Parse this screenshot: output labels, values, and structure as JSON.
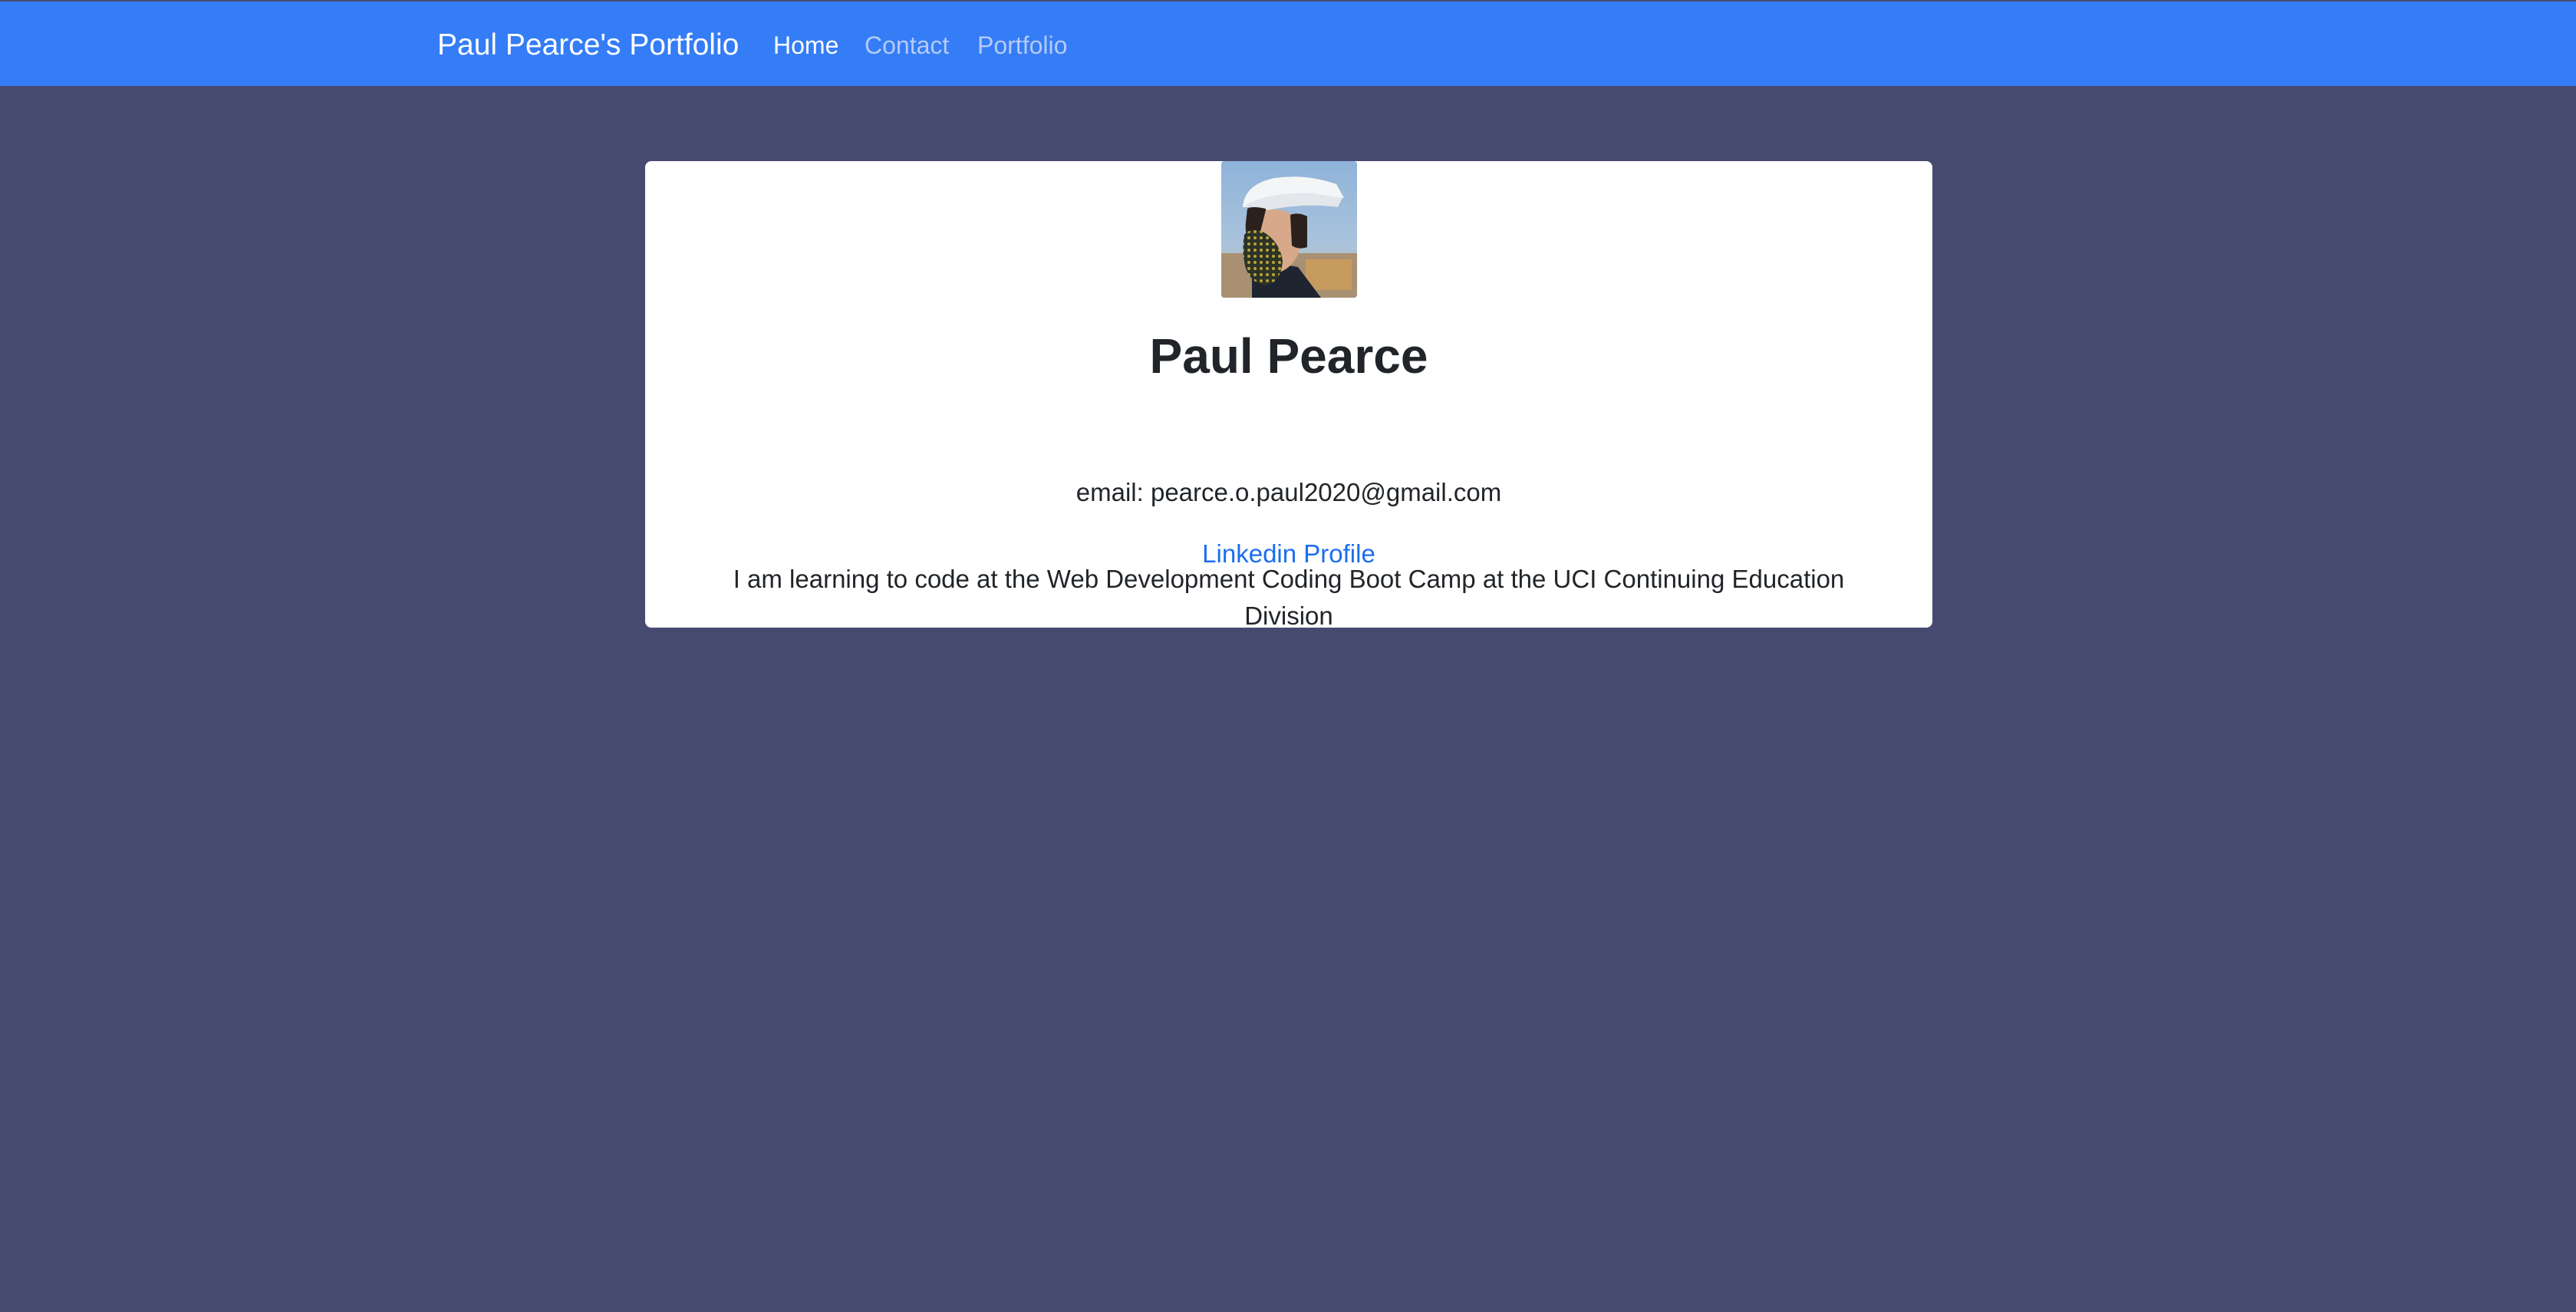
{
  "navbar": {
    "brand": "Paul Pearce's Portfolio",
    "links": [
      {
        "label": "Home",
        "active": true
      },
      {
        "label": "Contact",
        "active": false
      },
      {
        "label": "Portfolio",
        "active": false
      }
    ]
  },
  "card": {
    "name": "Paul Pearce",
    "description": "I am learning to code at the Web Development Coding Boot Camp at the UCI Continuing Education Division",
    "email": "email: pearce.o.paul2020@gmail.com",
    "link_label": "Linkedin Profile"
  },
  "colors": {
    "navbar": "#357cf7",
    "background": "#474a70",
    "link": "#1b6ef0"
  }
}
